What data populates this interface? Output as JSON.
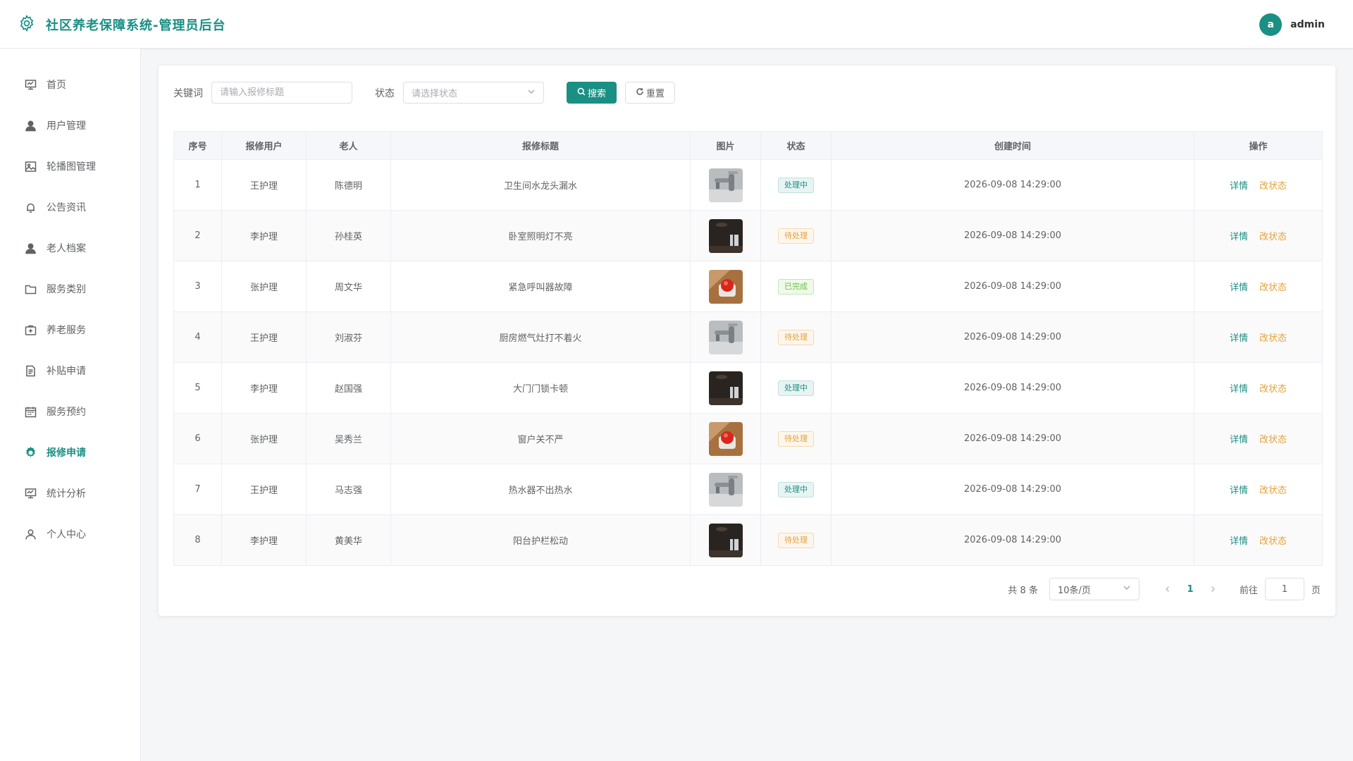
{
  "app": {
    "title": "社区养老保障系统-管理员后台",
    "user": {
      "avatar_letter": "a",
      "name": "admin"
    },
    "accent_color": "#1a8f84"
  },
  "sidebar": {
    "items": [
      {
        "label": "首页",
        "icon": "monitor-icon",
        "active": false
      },
      {
        "label": "用户管理",
        "icon": "user-icon",
        "active": false
      },
      {
        "label": "轮播图管理",
        "icon": "picture-icon",
        "active": false
      },
      {
        "label": "公告资讯",
        "icon": "bell-icon",
        "active": false
      },
      {
        "label": "老人档案",
        "icon": "user-icon",
        "active": false
      },
      {
        "label": "服务类别",
        "icon": "folder-icon",
        "active": false
      },
      {
        "label": "养老服务",
        "icon": "first-aid-icon",
        "active": false
      },
      {
        "label": "补贴申请",
        "icon": "document-icon",
        "active": false
      },
      {
        "label": "服务预约",
        "icon": "calendar-icon",
        "active": false
      },
      {
        "label": "报修申请",
        "icon": "gear-icon",
        "active": true
      },
      {
        "label": "统计分析",
        "icon": "monitor-icon",
        "active": false
      },
      {
        "label": "个人中心",
        "icon": "user-outline-icon",
        "active": false
      }
    ]
  },
  "search": {
    "keyword_label": "关键词",
    "keyword_placeholder": "请输入报修标题",
    "status_label": "状态",
    "status_placeholder": "请选择状态",
    "search_button": "搜索",
    "reset_button": "重置"
  },
  "table": {
    "columns": [
      "序号",
      "报修用户",
      "老人",
      "报修标题",
      "图片",
      "状态",
      "创建时间",
      "操作"
    ],
    "rows": [
      {
        "index": "1",
        "reporter": "王护理",
        "elder": "陈德明",
        "title": "卫生间水龙头漏水",
        "image": "faucet",
        "status": "处理中",
        "status_type": "proc",
        "created": "2026-09-08 14:29:00"
      },
      {
        "index": "2",
        "reporter": "李护理",
        "elder": "孙桂英",
        "title": "卧室照明灯不亮",
        "image": "room",
        "status": "待处理",
        "status_type": "wait",
        "created": "2026-09-08 14:29:00"
      },
      {
        "index": "3",
        "reporter": "张护理",
        "elder": "周文华",
        "title": "紧急呼叫器故障",
        "image": "button",
        "status": "已完成",
        "status_type": "done",
        "created": "2026-09-08 14:29:00"
      },
      {
        "index": "4",
        "reporter": "王护理",
        "elder": "刘淑芬",
        "title": "厨房燃气灶打不着火",
        "image": "faucet",
        "status": "待处理",
        "status_type": "wait",
        "created": "2026-09-08 14:29:00"
      },
      {
        "index": "5",
        "reporter": "李护理",
        "elder": "赵国强",
        "title": "大门门锁卡顿",
        "image": "room",
        "status": "处理中",
        "status_type": "proc",
        "created": "2026-09-08 14:29:00"
      },
      {
        "index": "6",
        "reporter": "张护理",
        "elder": "吴秀兰",
        "title": "窗户关不严",
        "image": "button",
        "status": "待处理",
        "status_type": "wait",
        "created": "2026-09-08 14:29:00"
      },
      {
        "index": "7",
        "reporter": "王护理",
        "elder": "马志强",
        "title": "热水器不出热水",
        "image": "faucet",
        "status": "处理中",
        "status_type": "proc",
        "created": "2026-09-08 14:29:00"
      },
      {
        "index": "8",
        "reporter": "李护理",
        "elder": "黄美华",
        "title": "阳台护栏松动",
        "image": "room",
        "status": "待处理",
        "status_type": "wait",
        "created": "2026-09-08 14:29:00"
      }
    ],
    "actions": {
      "detail": "详情",
      "change_status": "改状态"
    }
  },
  "pagination": {
    "total_text": "共 8 条",
    "page_size": "10条/页",
    "current_page": "1",
    "goto_label": "前往",
    "goto_value": "1",
    "page_unit": "页"
  }
}
